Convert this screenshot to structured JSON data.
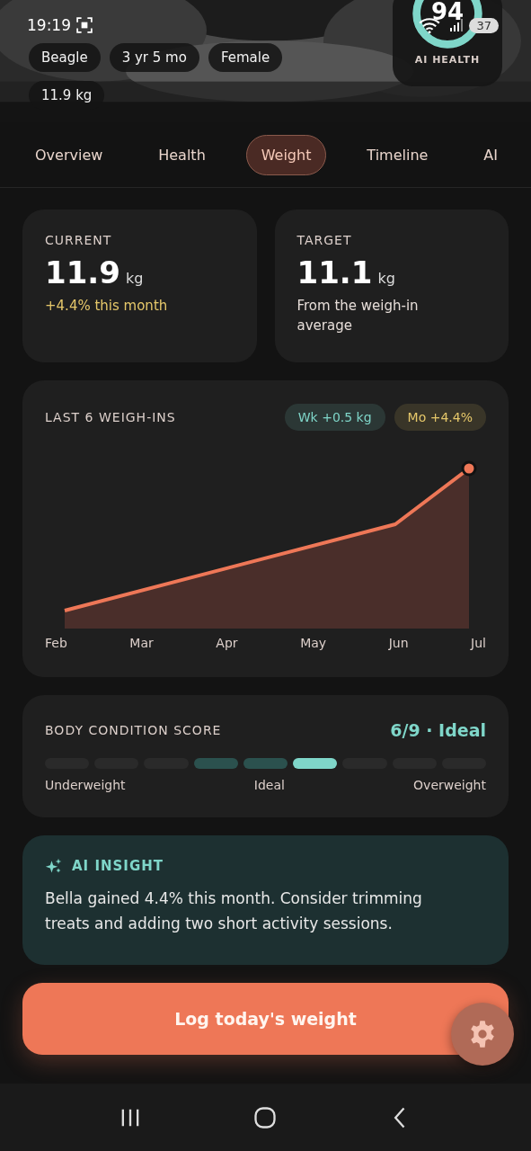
{
  "status_bar": {
    "time": "19:19",
    "battery": "37"
  },
  "header": {
    "chips": [
      "Beagle",
      "3 yr 5 mo",
      "Female",
      "11.9 kg"
    ],
    "health_card": {
      "score": "94",
      "label": "AI HEALTH"
    }
  },
  "tabs": [
    {
      "label": "Overview",
      "selected": false
    },
    {
      "label": "Health",
      "selected": false
    },
    {
      "label": "Weight",
      "selected": true
    },
    {
      "label": "Timeline",
      "selected": false
    },
    {
      "label": "AI",
      "selected": false
    }
  ],
  "stats": [
    {
      "label": "CURRENT",
      "value": "11.9",
      "unit": "kg",
      "note": "+4.4% this month",
      "kind": "change"
    },
    {
      "label": "TARGET",
      "value": "11.1",
      "unit": "kg",
      "note": "From the weigh-in average",
      "kind": "info"
    }
  ],
  "weigh_ins": {
    "title": "LAST 6 WEIGH-INS",
    "badges": [
      {
        "text": "Wk +0.5 kg",
        "color": "#7fd6c9"
      },
      {
        "text": "Mo +4.4%",
        "color": "#e6c86a"
      }
    ],
    "months": [
      "Feb",
      "Mar",
      "Apr",
      "May",
      "Jun",
      "Jul"
    ]
  },
  "body_condition": {
    "title": "BODY CONDITION SCORE",
    "score": "6/9 · Ideal",
    "segments": [
      {
        "kind": "plain"
      },
      {
        "kind": "plain"
      },
      {
        "kind": "plain"
      },
      {
        "kind": "ideal"
      },
      {
        "kind": "ideal"
      },
      {
        "kind": "current"
      },
      {
        "kind": "plain"
      },
      {
        "kind": "plain"
      },
      {
        "kind": "plain"
      }
    ],
    "scale": [
      "Underweight",
      "Ideal",
      "Overweight"
    ]
  },
  "insight": {
    "title": "AI INSIGHT",
    "text": "Bella gained 4.4% this month. Consider trimming treats and adding two short activity sessions."
  },
  "log_button": "Log today's weight"
}
